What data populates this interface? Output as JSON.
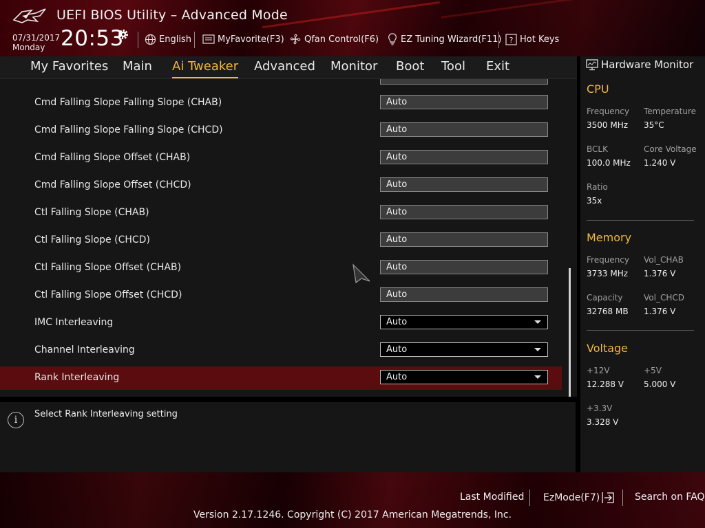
{
  "header": {
    "title": "UEFI BIOS Utility – Advanced Mode",
    "date": "07/31/2017",
    "weekday": "Monday",
    "time": "20:53",
    "items": {
      "language": "English",
      "favorite": "MyFavorite(F3)",
      "qfan": "Qfan Control(F6)",
      "ez_tuning": "EZ Tuning Wizard(F11)",
      "hotkeys": "Hot Keys"
    }
  },
  "nav": {
    "tabs": [
      "My Favorites",
      "Main",
      "Ai Tweaker",
      "Advanced",
      "Monitor",
      "Boot",
      "Tool",
      "Exit"
    ],
    "active": "Ai Tweaker",
    "accent": "#f1b83d"
  },
  "settings": [
    {
      "label": "Cmd Falling Slope Falling Slope (CHAB)",
      "value": "Auto"
    },
    {
      "label": "Cmd Falling Slope Falling Slope (CHCD)",
      "value": "Auto"
    },
    {
      "label": "Cmd Falling Slope Offset (CHAB)",
      "value": "Auto"
    },
    {
      "label": "Cmd Falling Slope Offset (CHCD)",
      "value": "Auto"
    },
    {
      "label": "Ctl Falling Slope (CHAB)",
      "value": "Auto"
    },
    {
      "label": "Ctl Falling Slope (CHCD)",
      "value": "Auto"
    },
    {
      "label": "Ctl Falling Slope Offset (CHAB)",
      "value": "Auto"
    },
    {
      "label": "Ctl Falling Slope Offset (CHCD)",
      "value": "Auto"
    },
    {
      "label": "IMC Interleaving",
      "value": "Auto"
    },
    {
      "label": "Channel Interleaving",
      "value": "Auto"
    },
    {
      "label": "Rank Interleaving",
      "value": "Auto"
    }
  ],
  "selected_setting": "Rank Interleaving",
  "help_text": "Select Rank Interleaving setting",
  "hw_monitor": {
    "title": "Hardware Monitor",
    "cpu": {
      "title": "CPU",
      "frequency_label": "Frequency",
      "frequency": "3500 MHz",
      "temperature_label": "Temperature",
      "temperature": "35°C",
      "bclk_label": "BCLK",
      "bclk": "100.0 MHz",
      "core_voltage_label": "Core Voltage",
      "core_voltage": "1.240 V",
      "ratio_label": "Ratio",
      "ratio": "35x"
    },
    "memory": {
      "title": "Memory",
      "frequency_label": "Frequency",
      "frequency": "3733 MHz",
      "vol_chab_label": "Vol_CHAB",
      "vol_chab": "1.376 V",
      "capacity_label": "Capacity",
      "capacity": "32768 MB",
      "vol_chcd_label": "Vol_CHCD",
      "vol_chcd": "1.376 V"
    },
    "voltage": {
      "title": "Voltage",
      "v12_label": "+12V",
      "v12": "12.288 V",
      "v5_label": "+5V",
      "v5": "5.000 V",
      "v33_label": "+3.3V",
      "v33": "3.328 V"
    }
  },
  "footer": {
    "last_modified": "Last Modified",
    "ezmode": "EzMode(F7)",
    "search_faq": "Search on FAQ",
    "copyright": "Version 2.17.1246. Copyright (C) 2017 American Megatrends, Inc."
  },
  "colors": {
    "accent": "#f1b83d",
    "selected_row": "#5a0c0f",
    "brand_red": "#6b0a12"
  }
}
